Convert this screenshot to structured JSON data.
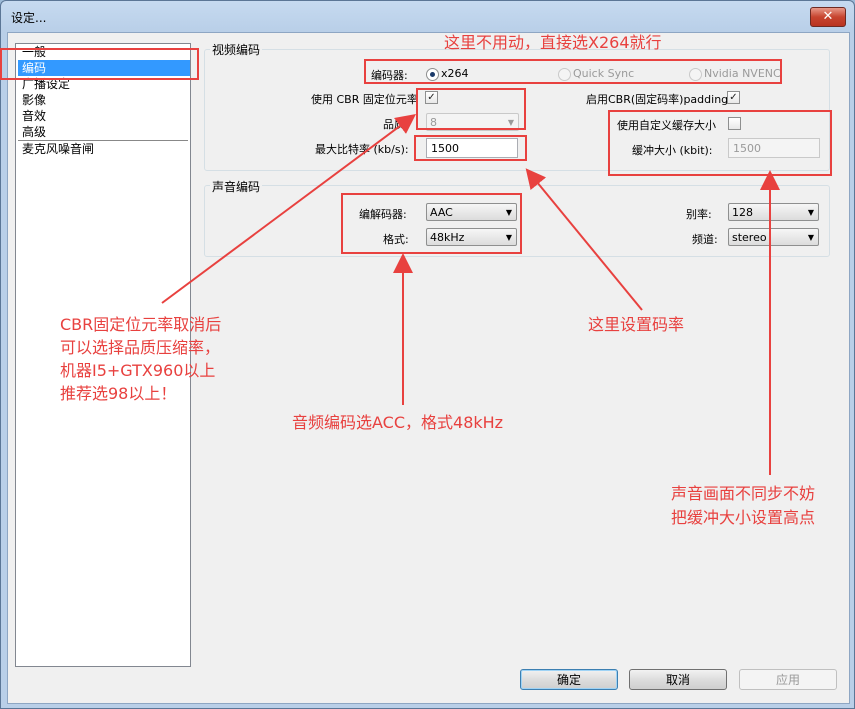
{
  "window": {
    "title": "设定...",
    "close_glyph": "✕"
  },
  "sidebar": {
    "items": [
      {
        "label": "一般"
      },
      {
        "label": "编码"
      },
      {
        "label": "广播设定"
      },
      {
        "label": "影像"
      },
      {
        "label": "音效"
      },
      {
        "label": "高级"
      },
      {
        "label": "麦克风噪音闸"
      }
    ],
    "selected_index": 1
  },
  "video": {
    "group_label": "视频编码",
    "encoder_label": "编码器:",
    "encoder_options": [
      "x264",
      "Quick Sync",
      "Nvidia NVENC"
    ],
    "encoder_selected": "x264",
    "cbr_label": "使用 CBR 固定位元率",
    "cbr_checked": true,
    "cbr_padding_label": "启用CBR(固定码率)padding",
    "cbr_padding_checked": true,
    "quality_label": "品质:",
    "quality_value": "8",
    "custom_buffer_label": "使用自定义缓存大小",
    "custom_buffer_checked": false,
    "bitrate_label": "最大比特率 (kb/s):",
    "bitrate_value": "1500",
    "buffer_label": "缓冲大小 (kbit):",
    "buffer_value": "1500"
  },
  "audio": {
    "group_label": "声音编码",
    "codec_label": "编解码器:",
    "codec_value": "AAC",
    "format_label": "格式:",
    "format_value": "48kHz",
    "bitrate_label": "别率:",
    "bitrate_value": "128",
    "channel_label": "频道:",
    "channel_value": "stereo"
  },
  "buttons": {
    "ok": "确定",
    "cancel": "取消",
    "apply": "应用"
  },
  "annotations": {
    "top_note": "这里不用动，直接选X264就行",
    "cbr_note": [
      "CBR固定位元率取消后",
      "可以选择品质压缩率，",
      "机器I5+GTX960以上",
      "推荐选98以上！"
    ],
    "bitrate_note": "这里设置码率",
    "audio_note": "音频编码选ACC，格式48kHz",
    "buffer_note": [
      "声音画面不同步不妨",
      "把缓冲大小设置高点"
    ]
  },
  "colors": {
    "annotation": "#e8413f",
    "selection": "#3399ff",
    "window_frame": "#b9cfe8"
  }
}
